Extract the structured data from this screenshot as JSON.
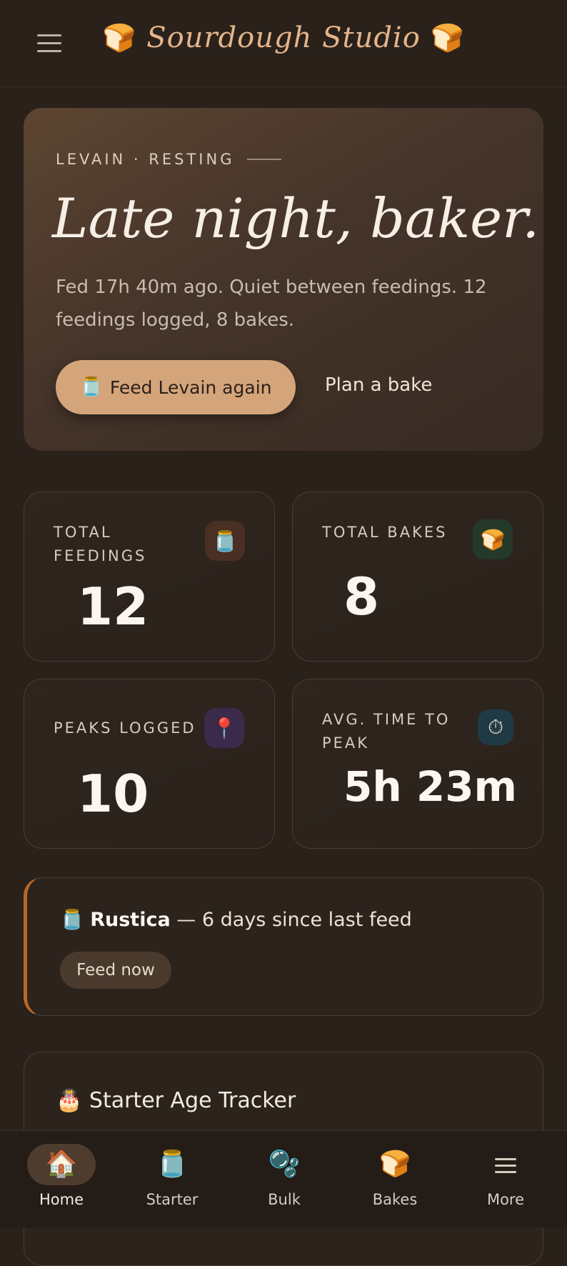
{
  "header": {
    "menu_icon": "menu-icon",
    "title": "Sourdough Studio",
    "bread_glyph": "🍞"
  },
  "hero": {
    "eyebrow": "LEVAIN · RESTING",
    "title": "Late night, baker.",
    "description": "Fed 17h 40m ago. Quiet between feedings. 12 feedings logged, 8 bakes.",
    "primary_icon": "🫙",
    "primary_label": "Feed Levain again",
    "secondary_label": "Plan a bake"
  },
  "stats": [
    {
      "label": "TOTAL FEEDINGS",
      "value": "12",
      "icon": "🫙",
      "icon_bg": "#4a2f25"
    },
    {
      "label": "TOTAL BAKES",
      "value": "8",
      "icon": "🍞",
      "icon_bg": "#25392a"
    },
    {
      "label": "PEAKS LOGGED",
      "value": "10",
      "icon": "📍",
      "icon_bg": "#3c2a4a"
    },
    {
      "label": "AVG. TIME TO PEAK",
      "value": "5h 23m",
      "icon": "⏱",
      "icon_bg": "#1f3a45"
    }
  ],
  "reminder": {
    "icon": "🫙",
    "name": "Rustica",
    "text": " — 6 days since last feed",
    "action": "Feed now",
    "accent": "#b7692c"
  },
  "age_tracker": {
    "icon": "🎂",
    "title": "Starter Age Tracker"
  },
  "nav": [
    {
      "label": "Home",
      "icon": "🏠",
      "active": true
    },
    {
      "label": "Starter",
      "icon": "🫙",
      "active": false
    },
    {
      "label": "Bulk",
      "icon": "🫧",
      "active": false
    },
    {
      "label": "Bakes",
      "icon": "🍞",
      "active": false
    },
    {
      "label": "More",
      "icon": "menu-icon",
      "active": false
    }
  ]
}
